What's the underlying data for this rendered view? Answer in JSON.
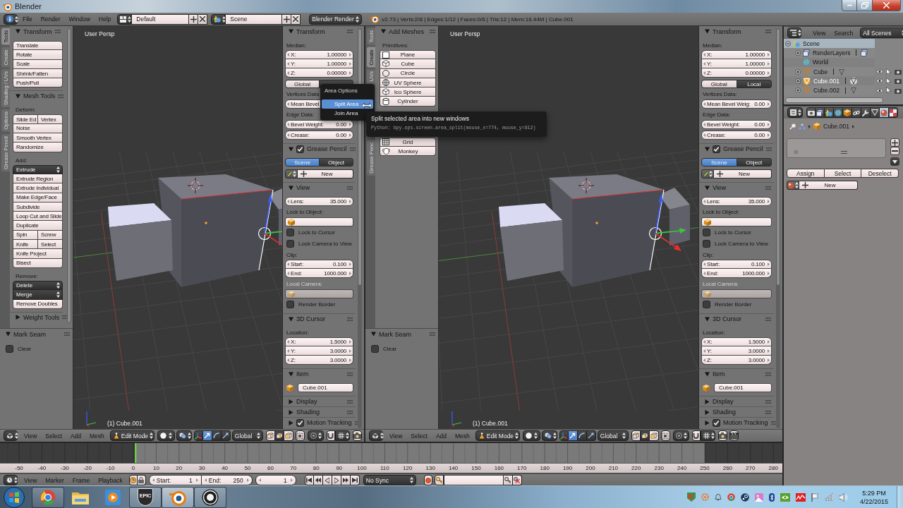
{
  "title_bar": {
    "title": "Blender"
  },
  "info_header": {
    "menus": [
      "File",
      "Render",
      "Window",
      "Help"
    ],
    "screen_layout": "Default",
    "scene": "Scene",
    "render_engine": "Blender Render",
    "stats": "v2.73 | Verts:2/8 | Edges:1/12 | Faces:0/6 | Tris:12 | Mem:16.44M | Cube.001"
  },
  "left_view": {
    "shelf_tabs": [
      {
        "label": "Tools",
        "selected": true
      },
      {
        "label": "Create",
        "selected": false
      },
      {
        "label": "Shading / UVs",
        "selected": false
      },
      {
        "label": "Options",
        "selected": false
      },
      {
        "label": "Grease Pencil",
        "selected": false
      }
    ],
    "tool_panels": [
      {
        "title": "Transform",
        "expanded": true,
        "rows": [
          {
            "kind": "buttons",
            "labels": [
              "Translate"
            ]
          },
          {
            "kind": "buttons",
            "labels": [
              "Rotate"
            ]
          },
          {
            "kind": "buttons",
            "labels": [
              "Scale"
            ]
          },
          {
            "kind": "buttons",
            "labels": [
              "Shrink/Fatten"
            ]
          },
          {
            "kind": "buttons",
            "labels": [
              "Push/Pull"
            ]
          }
        ]
      },
      {
        "title": "Mesh Tools",
        "expanded": true,
        "rows": [
          {
            "kind": "label",
            "text": "Deform:"
          },
          {
            "kind": "buttons",
            "labels": [
              "Slide Ed",
              "Vertex"
            ]
          },
          {
            "kind": "buttons",
            "labels": [
              "Noise"
            ]
          },
          {
            "kind": "buttons",
            "labels": [
              "Smooth Vertex"
            ]
          },
          {
            "kind": "buttons",
            "labels": [
              "Randomize"
            ]
          },
          {
            "kind": "label",
            "text": "Add:"
          },
          {
            "kind": "menu",
            "label": "Extrude"
          },
          {
            "kind": "buttons",
            "labels": [
              "Extrude Region"
            ]
          },
          {
            "kind": "buttons",
            "labels": [
              "Extrude Individual"
            ]
          },
          {
            "kind": "buttons",
            "labels": [
              "Make Edge/Face"
            ]
          },
          {
            "kind": "buttons",
            "labels": [
              "Subdivide"
            ]
          },
          {
            "kind": "buttons",
            "labels": [
              "Loop Cut and Slide"
            ]
          },
          {
            "kind": "buttons",
            "labels": [
              "Duplicate"
            ]
          },
          {
            "kind": "buttons",
            "labels": [
              "Spin",
              "Screw"
            ]
          },
          {
            "kind": "buttons",
            "labels": [
              "Knife",
              "Select"
            ]
          },
          {
            "kind": "buttons",
            "labels": [
              "Knife Project"
            ]
          },
          {
            "kind": "buttons",
            "labels": [
              "Bisect"
            ]
          },
          {
            "kind": "label",
            "text": "Remove:"
          },
          {
            "kind": "menu",
            "label": "Delete"
          },
          {
            "kind": "menu",
            "label": "Merge"
          },
          {
            "kind": "buttons",
            "labels": [
              "Remove Doubles"
            ]
          }
        ]
      },
      {
        "title": "Weight Tools",
        "expanded": false
      }
    ],
    "operator_panel": {
      "title": "Mark Seam",
      "expanded": true,
      "rows": [
        {
          "kind": "checkbox",
          "label": "Clear",
          "checked": false
        }
      ]
    },
    "view_label": "User Persp",
    "object_label": "(1) Cube.001",
    "n_panel": [
      {
        "title": "Transform",
        "expanded": true,
        "rows": [
          {
            "kind": "label",
            "text": "Median:",
            "disabled": false
          },
          {
            "kind": "fields",
            "items": [
              {
                "label": "X:",
                "value": "1.00000"
              },
              {
                "label": "Y:",
                "value": "1.00000"
              },
              {
                "label": "Z:",
                "value": "0.00000"
              }
            ]
          },
          {
            "kind": "toggle",
            "options": [
              {
                "label": "Global",
                "selected": false
              },
              {
                "selected": true
              }
            ]
          },
          {
            "kind": "label",
            "text": "Vertices Data",
            "disabled": false
          },
          {
            "kind": "sliders",
            "items": [
              {
                "label": "Mean Bevel"
              }
            ]
          },
          {
            "kind": "label",
            "text": "Edge Data:",
            "disabled": false
          },
          {
            "kind": "sliders",
            "items": [
              {
                "label": "Bevel Weight:",
                "value": "0.00"
              },
              {
                "label": "Crease:",
                "value": "0.00"
              }
            ]
          }
        ]
      },
      {
        "title": "Grease Pencil",
        "expanded": true,
        "header_checkbox": {
          "checked": true
        },
        "rows": [
          {
            "kind": "radio",
            "options": [
              {
                "label": "Scene",
                "selected": true
              },
              {
                "label": "Object",
                "selected": false
              }
            ]
          },
          {
            "kind": "new",
            "label": "New"
          }
        ]
      },
      {
        "title": "View",
        "expanded": true,
        "rows": [
          {
            "kind": "fields",
            "items": [
              {
                "label": "Lens:",
                "value": "35.000"
              }
            ]
          },
          {
            "kind": "label",
            "text": "Lock to Object:",
            "disabled": false
          },
          {
            "kind": "object_field",
            "disabled": false
          },
          {
            "kind": "checkbox",
            "label": "Lock to Cursor",
            "checked": false
          },
          {
            "kind": "checkbox",
            "label": "Lock Camera to View",
            "checked": false
          },
          {
            "kind": "label",
            "text": "Clip:",
            "disabled": false
          },
          {
            "kind": "fields",
            "items": [
              {
                "label": "Start:",
                "value": "0.100"
              },
              {
                "label": "End:",
                "value": "1000.000"
              }
            ]
          },
          {
            "kind": "label",
            "text": "Local Camera:",
            "disabled": true
          },
          {
            "kind": "object_field",
            "disabled": true
          },
          {
            "kind": "checkbox",
            "label": "Render Border",
            "checked": false
          }
        ]
      },
      {
        "title": "3D Cursor",
        "expanded": true,
        "rows": [
          {
            "kind": "label",
            "text": "Location:",
            "disabled": false
          },
          {
            "kind": "fields",
            "items": [
              {
                "label": "X:",
                "value": "1.5000"
              },
              {
                "label": "Y:",
                "value": "3.0000"
              },
              {
                "label": "Z:",
                "value": "3.0000"
              }
            ]
          }
        ]
      },
      {
        "title": "Item",
        "expanded": true,
        "rows": [
          {
            "kind": "name_field",
            "value": "Cube.001"
          }
        ]
      },
      {
        "title": "Display",
        "expanded": false
      },
      {
        "title": "Shading",
        "expanded": false
      },
      {
        "title": "Motion Tracking",
        "expanded": false,
        "header_checkbox": {
          "checked": true
        }
      }
    ],
    "header": {
      "menus": [
        "View",
        "Select",
        "Add",
        "Mesh"
      ],
      "mode": "Edit Mode",
      "orientation": "Global",
      "manipulators": [
        {
          "kind": "translate",
          "selected": true
        },
        {
          "kind": "rotate",
          "selected": false
        },
        {
          "kind": "scale",
          "selected": false
        }
      ],
      "select_modes": [
        {
          "kind": "vertex",
          "selected": false
        },
        {
          "kind": "edge",
          "selected": true
        },
        {
          "kind": "face",
          "selected": false
        }
      ],
      "render_buttons": [
        {
          "kind": "still"
        }
      ]
    }
  },
  "right_view": {
    "shelf_tabs": [
      {
        "label": "Tools",
        "selected": false
      },
      {
        "label": "Create",
        "selected": true
      },
      {
        "label": "UVs",
        "selected": false
      },
      {
        "label": "Grease Penc",
        "selected": false
      }
    ],
    "tool_panels": [
      {
        "title": "Add Meshes",
        "expanded": true,
        "rows": [
          {
            "kind": "label",
            "text": "Primitives:"
          },
          {
            "kind": "plane",
            "label": "Plane"
          },
          {
            "kind": "cube",
            "label": "Cube"
          },
          {
            "kind": "circle",
            "label": "Circle"
          },
          {
            "kind": "uv_sphere",
            "label": "UV Sphere"
          },
          {
            "kind": "ico_sphere",
            "label": "Ico Sphere"
          },
          {
            "kind": "cylinder",
            "label": "Cylinder"
          },
          {
            "kind": "gap"
          },
          {
            "kind": "grid",
            "label": "Grid"
          },
          {
            "kind": "monkey",
            "label": "Monkey"
          }
        ]
      }
    ],
    "operator_panel": {
      "title": "Mark Seam",
      "expanded": true,
      "rows": [
        {
          "kind": "checkbox",
          "label": "Clear",
          "checked": false
        }
      ]
    },
    "view_label": "User Persp",
    "object_label": "(1) Cube.001",
    "n_panel": [
      {
        "title": "Transform",
        "expanded": true,
        "rows": [
          {
            "kind": "label",
            "text": "Median:",
            "disabled": false
          },
          {
            "kind": "fields",
            "items": [
              {
                "label": "X:",
                "value": "1.00000"
              },
              {
                "label": "Y:",
                "value": "1.00000"
              },
              {
                "label": "Z:",
                "value": "0.00000"
              }
            ]
          },
          {
            "kind": "toggle",
            "options": [
              {
                "label": "Global",
                "selected": false
              },
              {
                "label": "Local",
                "selected": true
              }
            ]
          },
          {
            "kind": "label",
            "text": "Vertices Data:",
            "disabled": false
          },
          {
            "kind": "sliders",
            "items": [
              {
                "label": "Mean Bevel Weig:",
                "value": "0.00"
              }
            ]
          },
          {
            "kind": "label",
            "text": "Edge Data:",
            "disabled": false
          },
          {
            "kind": "sliders",
            "items": [
              {
                "label": "Bevel Weight:",
                "value": "0.00"
              },
              {
                "label": "Crease:",
                "value": "0.00"
              }
            ]
          }
        ]
      },
      {
        "title": "Grease Pencil",
        "expanded": true,
        "header_checkbox": {
          "checked": true
        },
        "rows": [
          {
            "kind": "radio",
            "options": [
              {
                "label": "Scene",
                "selected": true
              },
              {
                "label": "Object",
                "selected": false
              }
            ]
          },
          {
            "kind": "new",
            "label": "New"
          }
        ]
      },
      {
        "title": "View",
        "expanded": true,
        "rows": [
          {
            "kind": "fields",
            "items": [
              {
                "label": "Lens:",
                "value": "35.000"
              }
            ]
          },
          {
            "kind": "label",
            "text": "Lock to Object:",
            "disabled": false
          },
          {
            "kind": "object_field",
            "disabled": false
          },
          {
            "kind": "checkbox",
            "label": "Lock to Cursor",
            "checked": false
          },
          {
            "kind": "checkbox",
            "label": "Lock Camera to View",
            "checked": false
          },
          {
            "kind": "label",
            "text": "Clip:",
            "disabled": false
          },
          {
            "kind": "fields",
            "items": [
              {
                "label": "Start:",
                "value": "0.100"
              },
              {
                "label": "End:",
                "value": "1000.000"
              }
            ]
          },
          {
            "kind": "label",
            "text": "Local Camera:",
            "disabled": true
          },
          {
            "kind": "object_field",
            "disabled": true
          },
          {
            "kind": "checkbox",
            "label": "Render Border",
            "checked": false
          }
        ]
      },
      {
        "title": "3D Cursor",
        "expanded": true,
        "rows": [
          {
            "kind": "label",
            "text": "Location:",
            "disabled": false
          },
          {
            "kind": "fields",
            "items": [
              {
                "label": "X:",
                "value": "1.5000"
              },
              {
                "label": "Y:",
                "value": "3.0000"
              },
              {
                "label": "Z:",
                "value": "3.0000"
              }
            ]
          }
        ]
      },
      {
        "title": "Item",
        "expanded": true,
        "rows": [
          {
            "kind": "name_field",
            "value": "Cube.001"
          }
        ]
      },
      {
        "title": "Display",
        "expanded": false
      },
      {
        "title": "Shading",
        "expanded": false
      },
      {
        "title": "Motion Tracking",
        "expanded": false,
        "header_checkbox": {
          "checked": true
        }
      }
    ],
    "header": {
      "menus": [
        "View",
        "Select",
        "Add",
        "Mesh"
      ],
      "mode": "Edit Mode",
      "orientation": "Global",
      "manipulators": [
        {
          "kind": "translate",
          "selected": true
        },
        {
          "kind": "rotate",
          "selected": false
        },
        {
          "kind": "scale",
          "selected": false
        }
      ],
      "select_modes": [
        {
          "kind": "vertex",
          "selected": false
        },
        {
          "kind": "edge",
          "selected": true
        },
        {
          "kind": "face",
          "selected": false
        }
      ],
      "render_buttons": [
        {
          "kind": "still"
        },
        {
          "kind": "animation"
        }
      ]
    }
  },
  "area_menu": {
    "title": "Area Options",
    "items": [
      {
        "label": "Split Area",
        "selected": true
      },
      {
        "label": "Join Area",
        "selected": false
      }
    ]
  },
  "tooltip": {
    "text": "Split selected area into new windows",
    "python": "Python: bpy.ops.screen.area_split(mouse_x=774, mouse_y=812)"
  },
  "timeline": {
    "ruler_labels": [
      "-50",
      "-40",
      "-30",
      "-20",
      "-10",
      "0",
      "10",
      "20",
      "30",
      "40",
      "50",
      "60",
      "70",
      "80",
      "90",
      "100",
      "110",
      "120",
      "130",
      "140",
      "150",
      "160",
      "170",
      "180",
      "190",
      "200",
      "210",
      "220",
      "230",
      "240",
      "250",
      "260",
      "270",
      "280"
    ],
    "menus": [
      "View",
      "Marker",
      "Frame",
      "Playback"
    ],
    "start": {
      "label": "Start:",
      "value": "1"
    },
    "end": {
      "label": "End:",
      "value": "250"
    },
    "current_frame": "1",
    "sync": "No Sync"
  },
  "outliner": {
    "menus": [
      "View",
      "Search"
    ],
    "scope": "All Scenes",
    "tree": [
      {
        "kind": "scene",
        "label": "Scene",
        "selected": true,
        "active": false,
        "expanded": true,
        "children": [
          {
            "kind": "render_layers",
            "label": "RenderLayers",
            "selected": false,
            "active": false,
            "expanded": false
          },
          {
            "kind": "world",
            "label": "World",
            "selected": false,
            "active": false
          },
          {
            "kind": "object",
            "label": "Cube",
            "selected": false,
            "active": false,
            "expanded": false
          },
          {
            "kind": "object",
            "label": "Cube.001",
            "selected": false,
            "active": true,
            "expanded": false
          },
          {
            "kind": "object",
            "label": "Cube.002",
            "selected": false,
            "active": false,
            "expanded": false
          }
        ]
      }
    ]
  },
  "properties": {
    "tabs": [
      {
        "kind": "render",
        "selected": false
      },
      {
        "kind": "render_layers",
        "selected": false
      },
      {
        "kind": "scene",
        "selected": false
      },
      {
        "kind": "world",
        "selected": false
      },
      {
        "kind": "object",
        "selected": false
      },
      {
        "kind": "constraints",
        "selected": false
      },
      {
        "kind": "modifiers",
        "selected": false
      },
      {
        "kind": "data",
        "selected": false
      },
      {
        "kind": "material",
        "selected": true
      },
      {
        "kind": "texture",
        "selected": false
      }
    ],
    "context": "Cube.001",
    "slot_buttons": [
      "Assign",
      "Select",
      "Deselect"
    ],
    "new_label": "New"
  },
  "taskbar": {
    "apps": [
      {
        "kind": "browser",
        "running": true,
        "selected": false
      },
      {
        "kind": "folder",
        "running": false,
        "selected": false
      },
      {
        "kind": "media",
        "running": false,
        "selected": false
      },
      {
        "kind": "epic",
        "label": "EPIC",
        "running": true,
        "selected": false
      },
      {
        "kind": "blender",
        "running": true,
        "selected": true
      },
      {
        "kind": "unreal",
        "running": true,
        "selected": false
      }
    ],
    "time": "5:29 PM",
    "date": "4/22/2015"
  }
}
